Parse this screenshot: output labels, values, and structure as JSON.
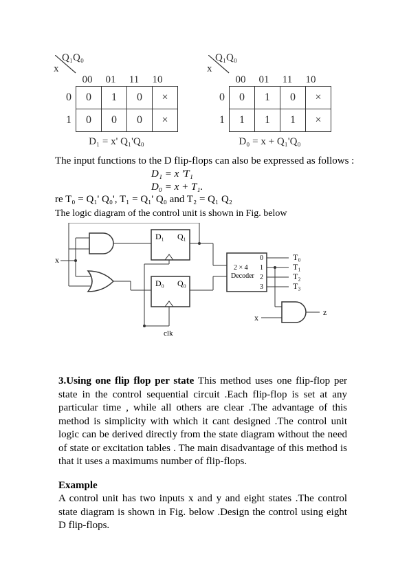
{
  "kmaps": {
    "col_header": "Q₁Q₀",
    "row_header": "x",
    "cols": [
      "00",
      "01",
      "11",
      "10"
    ],
    "rows": [
      "0",
      "1"
    ],
    "left": {
      "cells": [
        [
          "0",
          "1",
          "0",
          "×"
        ],
        [
          "0",
          "0",
          "0",
          "×"
        ]
      ],
      "equation": "D₁ = x' Q₁'Q₀"
    },
    "right": {
      "cells": [
        [
          "0",
          "1",
          "0",
          "×"
        ],
        [
          "1",
          "1",
          "1",
          "×"
        ]
      ],
      "equation": "D₀ = x + Q₁'Q₀"
    }
  },
  "text": {
    "intro": "The input functions to the D flip-flops can also be expressed as follows :",
    "eq1": "D₁ = x 'T₁",
    "eq2": "D₀ = x + T₁.",
    "cond": "re T₀ = Q₁' Q₀', T₁ = Q₁' Q₀ and T₂ = Q₁ Q₂",
    "caption": "The logic diagram of the control unit is shown in Fig. below"
  },
  "logic": {
    "ff1_in": "D₁",
    "ff1_out": "Q₁",
    "ff0_in": "D₀",
    "ff0_out": "Q₀",
    "decoder_l1": "2 × 4",
    "decoder_l2": "Decoder",
    "dec_in1": "0",
    "dec_in2": "1",
    "dec_in3": "2",
    "dec_in4": "3",
    "out0": "T₀",
    "out1": "T₁",
    "out2": "T₂",
    "out3": "T₃",
    "x": "x",
    "z": "z",
    "clk": "clk"
  },
  "body": {
    "section_head": "3.Using one flip flop per state",
    "section_body": " This method uses one flip-flop per state in the control sequential circuit .Each flip-flop is set at any particular time , while all others are clear .The advantage of this method is simplicity with which it cant designed .The control unit logic can be derived directly from the state diagram without the need of state or excitation tables . The main disadvantage of this method is that it uses a maximums number of flip-flops.",
    "example_head": "Example",
    "example_body": "A control unit has two inputs x and y and eight states .The control state diagram is shown in Fig. below .Design the control using eight D flip-flops."
  },
  "chart_data": [
    {
      "type": "table",
      "title": "K-map for D1",
      "xlabel": "Q1Q0",
      "ylabel": "x",
      "categories": [
        "00",
        "01",
        "11",
        "10"
      ],
      "rows": [
        "0",
        "1"
      ],
      "values": [
        [
          "0",
          "1",
          "0",
          "X"
        ],
        [
          "0",
          "0",
          "0",
          "X"
        ]
      ],
      "equation": "D1 = x' Q1' Q0"
    },
    {
      "type": "table",
      "title": "K-map for D0",
      "xlabel": "Q1Q0",
      "ylabel": "x",
      "categories": [
        "00",
        "01",
        "11",
        "10"
      ],
      "rows": [
        "0",
        "1"
      ],
      "values": [
        [
          "0",
          "1",
          "0",
          "X"
        ],
        [
          "1",
          "1",
          "1",
          "X"
        ]
      ],
      "equation": "D0 = x + Q1' Q0"
    }
  ]
}
